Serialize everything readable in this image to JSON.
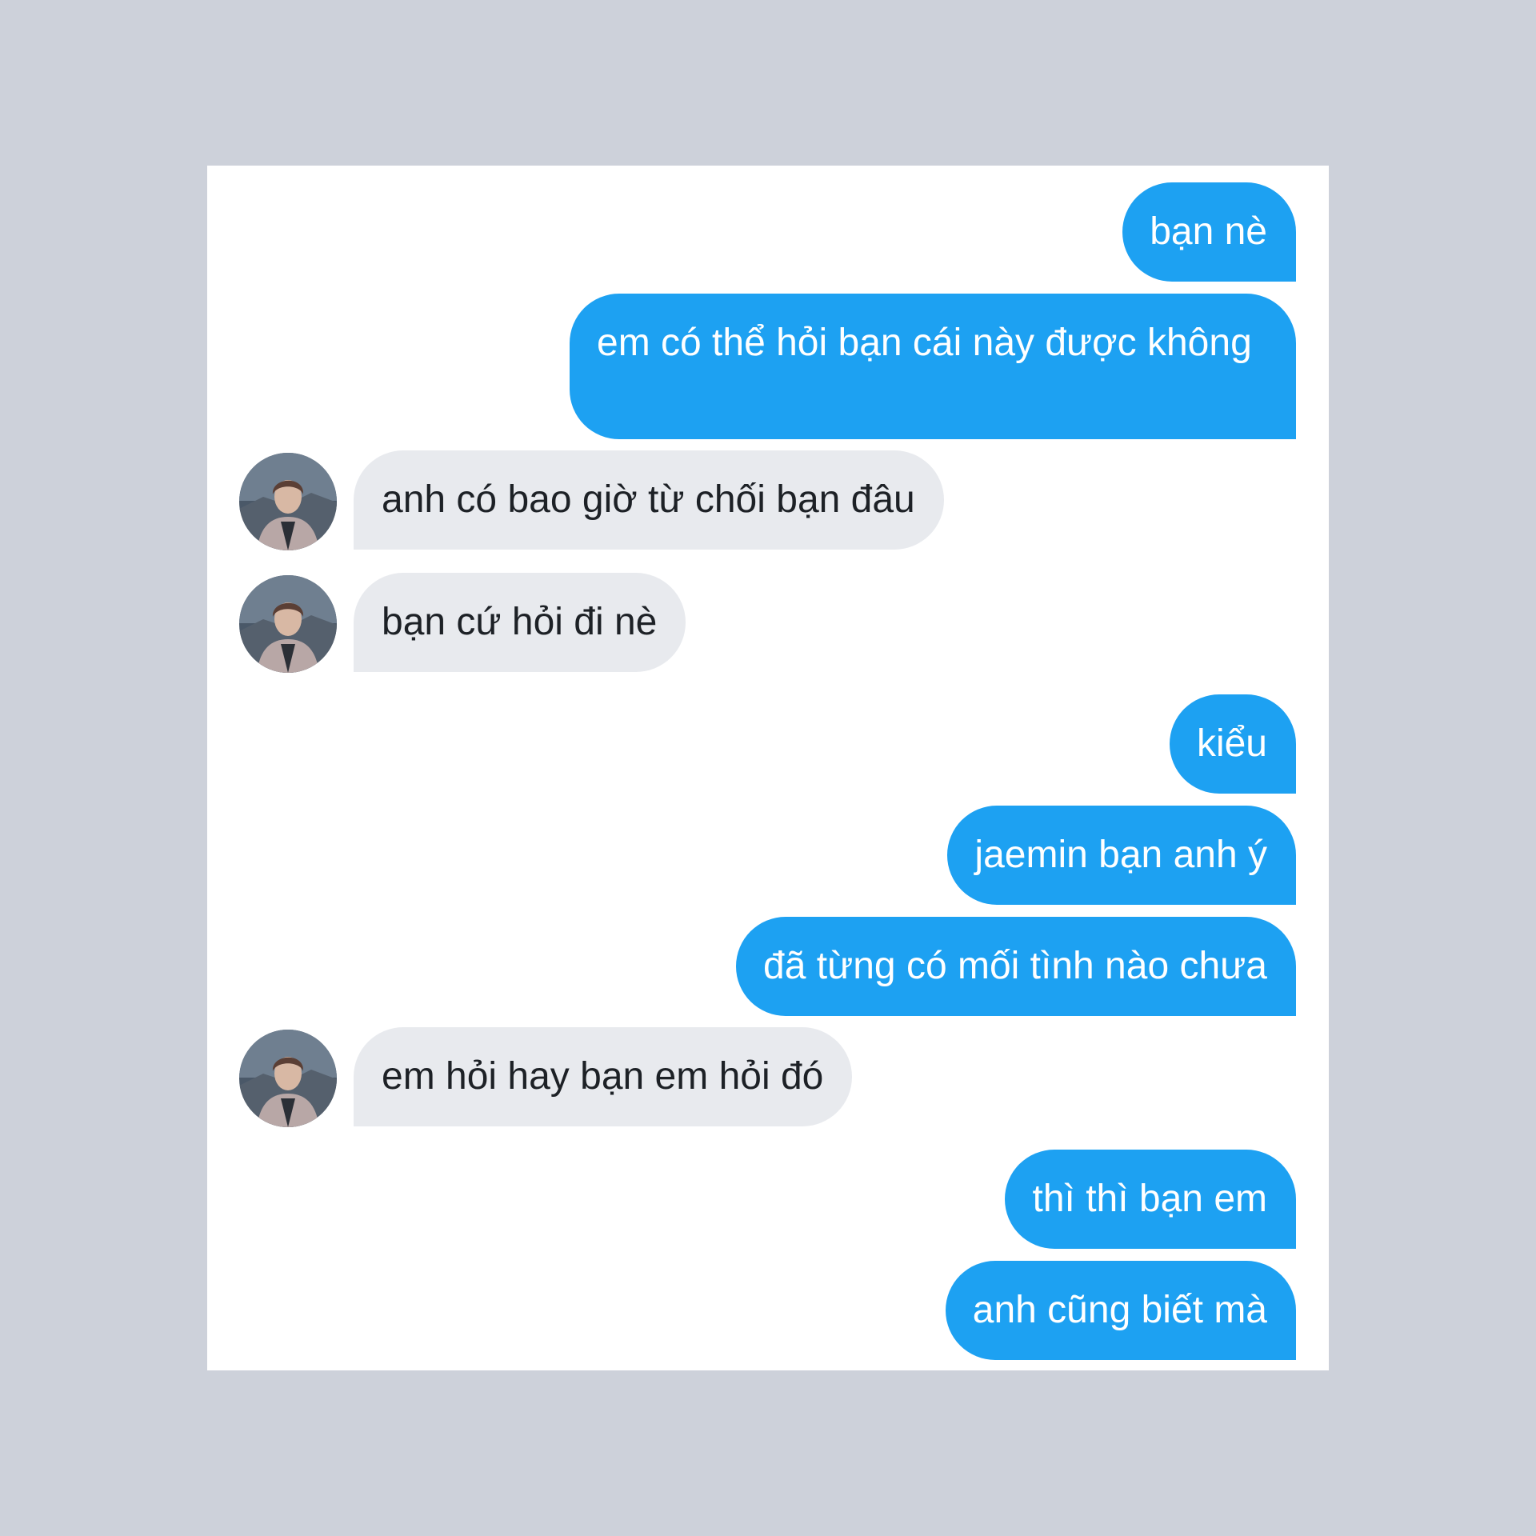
{
  "colors": {
    "page_background": "#cdd1da",
    "card_background": "#ffffff",
    "outgoing_bubble": "#1da1f2",
    "incoming_bubble": "#e8eaee"
  },
  "messages": [
    {
      "direction": "outgoing",
      "text": "bạn nè"
    },
    {
      "direction": "outgoing",
      "text": "em có thể hỏi bạn cái này được không"
    },
    {
      "direction": "incoming",
      "text": "anh có bao giờ từ chối bạn đâu",
      "avatar_icon": "avatar"
    },
    {
      "direction": "incoming",
      "text": "bạn cứ hỏi đi nè",
      "avatar_icon": "avatar"
    },
    {
      "direction": "outgoing",
      "text": "kiểu"
    },
    {
      "direction": "outgoing",
      "text": "jaemin bạn anh ý"
    },
    {
      "direction": "outgoing",
      "text": "đã từng có mối tình nào chưa"
    },
    {
      "direction": "incoming",
      "text": "em hỏi hay bạn em hỏi đó",
      "avatar_icon": "avatar"
    },
    {
      "direction": "outgoing",
      "text": "thì thì bạn em"
    },
    {
      "direction": "outgoing",
      "text": "anh cũng biết mà"
    }
  ]
}
